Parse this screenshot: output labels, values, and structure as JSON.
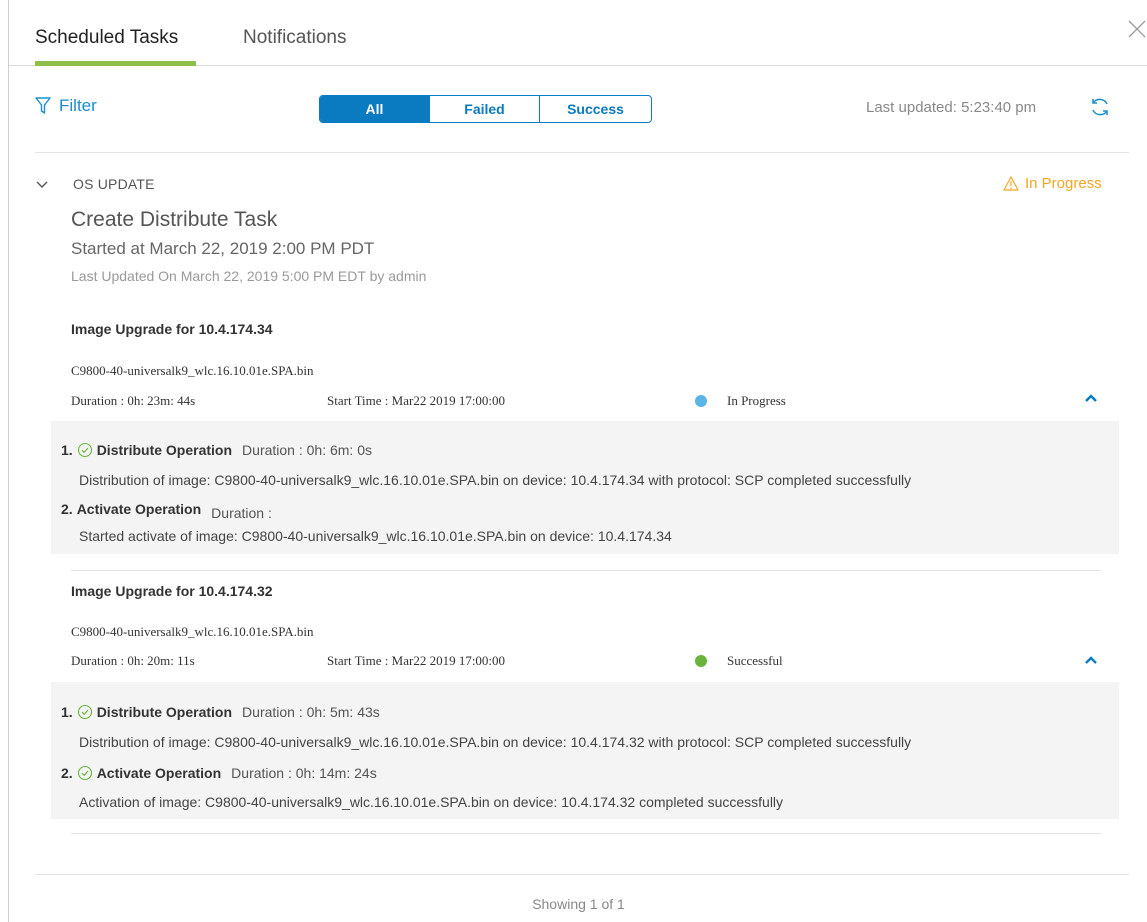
{
  "tabs": [
    {
      "label": "Scheduled Tasks",
      "active": true
    },
    {
      "label": "Notifications",
      "active": false
    }
  ],
  "toolbar": {
    "filter_label": "Filter",
    "segments": [
      {
        "label": "All",
        "active": true
      },
      {
        "label": "Failed",
        "active": false
      },
      {
        "label": "Success",
        "active": false
      }
    ],
    "last_updated": "Last updated: 5:23:40 pm"
  },
  "section": {
    "title": "OS UPDATE",
    "status": "In Progress",
    "task_name": "Create Distribute Task",
    "started": "Started at March 22, 2019 2:00 PM PDT",
    "last_updated": "Last Updated On March 22, 2019 5:00 PM EDT by admin"
  },
  "upgrades": [
    {
      "title": "Image Upgrade for 10.4.174.34",
      "file": "C9800-40-universalk9_wlc.16.10.01e.SPA.bin",
      "duration": "Duration : 0h: 23m: 44s",
      "start_time": "Start Time : Mar22 2019 17:00:00",
      "status": "In Progress",
      "status_color": "#5ab4e5",
      "operations": [
        {
          "num": "1.",
          "name": "Distribute Operation",
          "duration": "Duration : 0h: 6m: 0s",
          "done": true,
          "desc": "Distribution of image: C9800-40-universalk9_wlc.16.10.01e.SPA.bin on device: 10.4.174.34 with protocol: SCP completed successfully"
        },
        {
          "num": "2.",
          "name": "Activate Operation",
          "duration": "Duration :",
          "done": false,
          "desc": "Started activate of image: C9800-40-universalk9_wlc.16.10.01e.SPA.bin on device: 10.4.174.34"
        }
      ]
    },
    {
      "title": "Image Upgrade for 10.4.174.32",
      "file": "C9800-40-universalk9_wlc.16.10.01e.SPA.bin",
      "duration": "Duration : 0h: 20m: 11s",
      "start_time": "Start Time : Mar22 2019 17:00:00",
      "status": "Successful",
      "status_color": "#6ab43e",
      "operations": [
        {
          "num": "1.",
          "name": "Distribute Operation",
          "duration": "Duration : 0h: 5m: 43s",
          "done": true,
          "desc": "Distribution of image: C9800-40-universalk9_wlc.16.10.01e.SPA.bin on device: 10.4.174.32 with protocol: SCP completed successfully"
        },
        {
          "num": "2.",
          "name": "Activate Operation",
          "duration": "Duration : 0h: 14m: 24s",
          "done": true,
          "desc": "Activation of image: C9800-40-universalk9_wlc.16.10.01e.SPA.bin on device: 10.4.174.32 completed successfully"
        }
      ]
    }
  ],
  "footer": "Showing 1 of 1",
  "colors": {
    "accent": "#0a7bc1",
    "tab_underline": "#8cc04b",
    "warning": "#f5a623",
    "success_check": "#6ab43e"
  },
  "icons": [
    "filter-icon",
    "refresh-icon",
    "close-icon",
    "chevron-down-icon",
    "warning-icon",
    "check-circle-icon",
    "caret-up-icon"
  ]
}
